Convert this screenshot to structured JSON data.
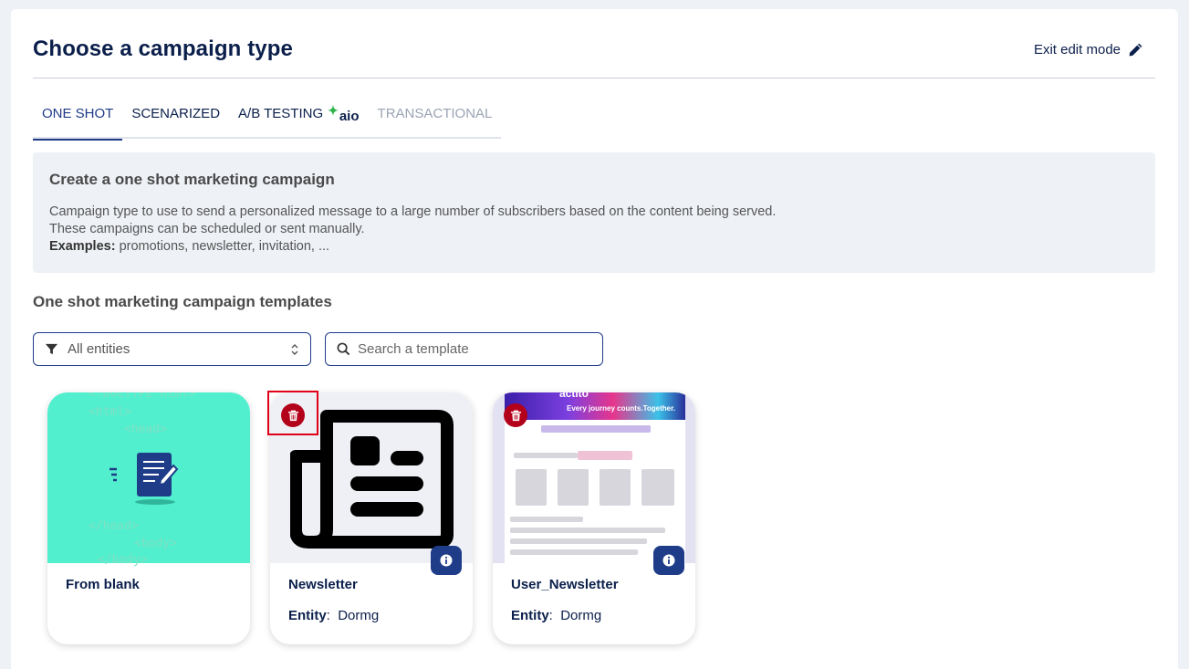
{
  "header": {
    "title": "Choose a campaign type",
    "exit_label": "Exit edit mode"
  },
  "tabs": [
    {
      "label": "ONE SHOT",
      "state": "active"
    },
    {
      "label": "SCENARIZED",
      "state": "normal"
    },
    {
      "label": "A/B TESTING",
      "badge": "aio",
      "state": "normal"
    },
    {
      "label": "TRANSACTIONAL",
      "state": "disabled"
    }
  ],
  "info": {
    "title": "Create a one shot marketing campaign",
    "line1": "Campaign type to use to send a personalized message to a large number of subscribers based on the content being served.",
    "line2": "These campaigns can be scheduled or sent manually.",
    "examples_label": "Examples:",
    "examples_value": " promotions, newsletter, invitation, ..."
  },
  "templates": {
    "section_title": "One shot marketing campaign templates",
    "filter_value": "All entities",
    "search_placeholder": "Search a template",
    "cards": [
      {
        "name": "From blank",
        "code_lines": [
          "<!DOCTYPE html>",
          "<html>",
          "<head>",
          "</head>",
          "<body>",
          "</body>"
        ]
      },
      {
        "name": "Newsletter",
        "entity_label": "Entity",
        "entity_value": "Dormg"
      },
      {
        "name": "User_Newsletter",
        "entity_label": "Entity",
        "entity_value": "Dormg",
        "banner_brand": "actito",
        "banner_tagline": "Every journey counts.Together."
      }
    ]
  },
  "colors": {
    "primary": "#1f3c88",
    "title": "#0b1f4b",
    "delete": "#b3001b",
    "blank_card": "#52efce",
    "highlight": "#e0001a"
  }
}
